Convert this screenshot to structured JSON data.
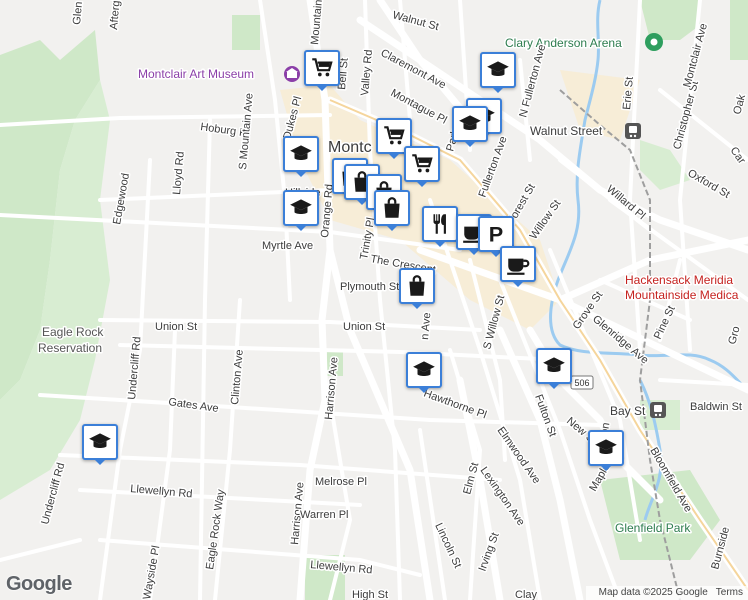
{
  "map": {
    "attribution": {
      "logo": "Google",
      "map_data": "Map data ©2025 Google",
      "terms": "Terms"
    },
    "colors": {
      "land": "#f2f1ef",
      "park": "#cfe8c8",
      "water": "#9ccbf0",
      "road": "#ffffff",
      "rail": "#9e9e9e",
      "marker_border": "#3b7fd8",
      "marker_icon": "#1a1a1a"
    },
    "places": [
      {
        "name": "Montclair Art Museum",
        "type": "museum"
      },
      {
        "name": "Clary Anderson Arena",
        "type": "arena"
      },
      {
        "name": "Walnut Street",
        "type": "train-station"
      },
      {
        "name": "Hackensack Meridian Mountainside Medical",
        "line1": "Hackensack Meridia",
        "line2": "Mountainside Medica",
        "type": "hospital"
      },
      {
        "name": "Eagle Rock Reservation",
        "line1": "Eagle Rock",
        "line2": "Reservation",
        "type": "park"
      },
      {
        "name": "Bay St",
        "type": "train-station"
      },
      {
        "name": "Glenfield Park",
        "type": "park"
      },
      {
        "name": "Montclair",
        "display": "Montc",
        "type": "town"
      }
    ],
    "route_shield": "506",
    "streets": [
      "Walnut St",
      "Claremont Ave",
      "Montague Pl",
      "Valley Rd",
      "Bell St",
      "Mountain Ave",
      "Afterglow",
      "Glen",
      "Hoburg Pl",
      "S Mountain Ave",
      "Lloyd Rd",
      "Orange Rd",
      "Myrtle Ave",
      "Hillside",
      "Trinity Pl",
      "The Crescent",
      "Plymouth St",
      "Union St",
      "Harrison Ave",
      "Clinton Ave",
      "Undercliff Rd",
      "Gates Ave",
      "Melrose Pl",
      "Llewellyn Rd",
      "Warren Pl",
      "Eagle Rock Way",
      "Hawthorne Pl",
      "Elm St",
      "Elmwood Ave",
      "Lexington Ave",
      "Irving St",
      "Lincoln St",
      "Fulton St",
      "S Willow St",
      "Willow St",
      "Forest St",
      "Willard Pl",
      "N Fullerton Ave",
      "Erie St",
      "Christopher St",
      "Montclair Ave",
      "Oxford St",
      "Grove St",
      "Glenridge Ave",
      "Pine St",
      "Baldwin St",
      "Bloomfield Ave",
      "Maple",
      "Mission",
      "New St",
      "High St",
      "Park",
      "Fullerton Ave",
      "Oak",
      "Car",
      "Gro",
      "Dukes Pl",
      "Edgewood",
      "Wayside Pl",
      "Clay",
      "Burnside",
      "n Ave"
    ],
    "markers": [
      {
        "icon": "shopping-cart-icon"
      },
      {
        "icon": "graduation-cap-icon"
      },
      {
        "icon": "graduation-cap-icon"
      },
      {
        "icon": "graduation-cap-icon"
      },
      {
        "icon": "graduation-cap-icon"
      },
      {
        "icon": "graduation-cap-icon"
      },
      {
        "icon": "shopping-cart-icon"
      },
      {
        "icon": "shopping-cart-icon"
      },
      {
        "icon": "shopping-bag-icon"
      },
      {
        "icon": "shopping-bag-icon"
      },
      {
        "icon": "shopping-bag-icon"
      },
      {
        "icon": "shopping-bag-icon"
      },
      {
        "icon": "restaurant-icon"
      },
      {
        "icon": "coffee-icon"
      },
      {
        "icon": "parking-icon"
      },
      {
        "icon": "coffee-icon"
      },
      {
        "icon": "shopping-bag-icon"
      },
      {
        "icon": "graduation-cap-icon"
      },
      {
        "icon": "graduation-cap-icon"
      },
      {
        "icon": "graduation-cap-icon"
      },
      {
        "icon": "graduation-cap-icon"
      }
    ]
  }
}
